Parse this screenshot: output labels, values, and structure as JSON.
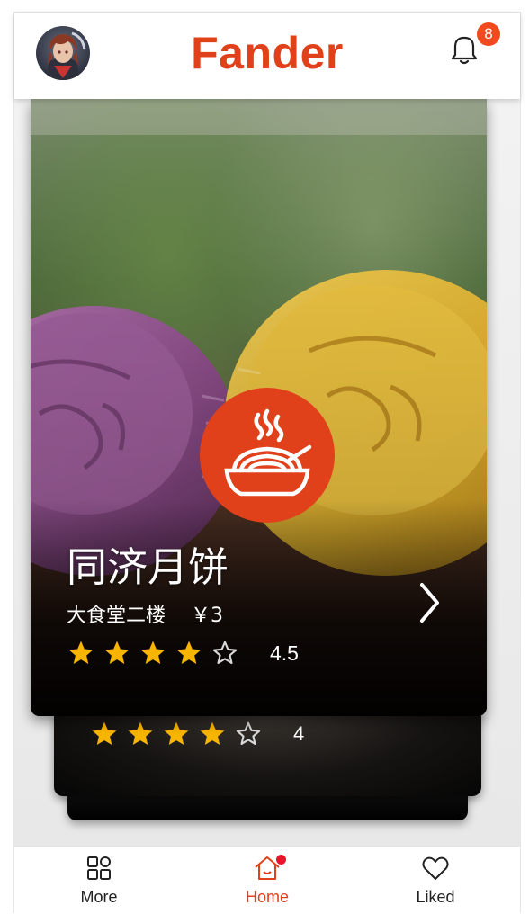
{
  "app": {
    "title": "Fander",
    "brand_color": "#e0411b"
  },
  "header": {
    "avatar_icon": "user-avatar",
    "notification_icon": "bell-icon",
    "notification_count": "8"
  },
  "main_card": {
    "name": "同济月饼",
    "location": "大食堂二楼",
    "price": "￥3",
    "rating": "4.5",
    "stars": {
      "filled": 4,
      "total": 5
    },
    "category_icon": "noodle-bowl-icon",
    "next_icon": "chevron-right-icon"
  },
  "back_card": {
    "rating": "4",
    "stars": {
      "filled": 4,
      "total": 5
    }
  },
  "bottom_nav": {
    "items": [
      {
        "label": "More",
        "icon": "grid-icon",
        "active": false
      },
      {
        "label": "Home",
        "icon": "home-icon",
        "active": true,
        "has_dot": true
      },
      {
        "label": "Liked",
        "icon": "heart-icon",
        "active": false
      }
    ]
  },
  "colors": {
    "star": "#f7b500",
    "star_empty_outline": "#d9d9d9",
    "badge": "#f14a1f",
    "nav_dot": "#e5162c"
  }
}
